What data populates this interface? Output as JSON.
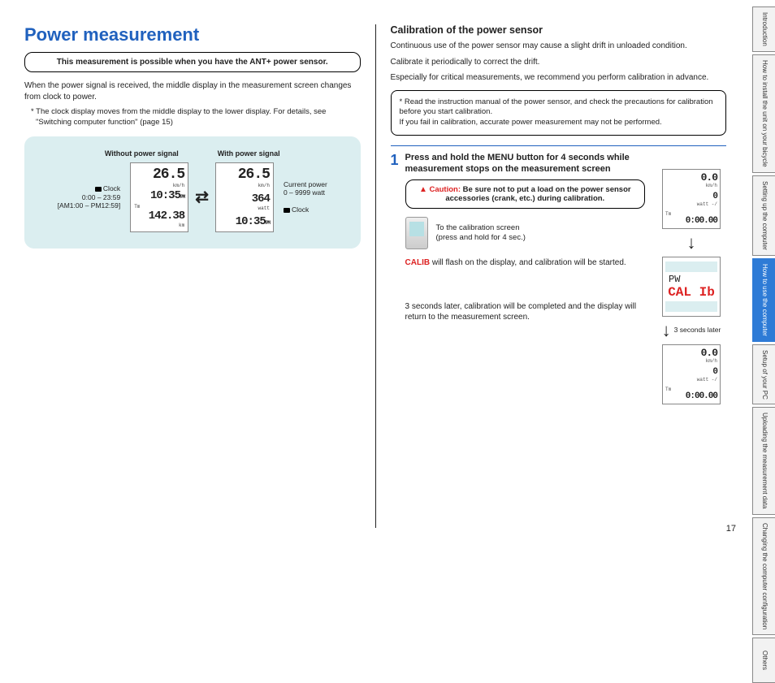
{
  "left": {
    "title": "Power measurement",
    "notice": "This measurement is possible when you have the ANT+ power sensor.",
    "intro": "When the power signal is received, the middle display in the measurement screen changes from clock to power.",
    "footnote": "* The clock display moves from the middle display to the lower display. For details, see \"Switching computer function\" (page 15)",
    "compare": {
      "header_left": "Without power signal",
      "header_right": "With power signal",
      "anno_clock_label": "Clock",
      "anno_clock_range": "0:00 – 23:59",
      "anno_clock_ampm": "[AM1:00 – PM12:59]",
      "anno_power_label": "Current power",
      "anno_power_range": "0 – 9999 watt",
      "anno_clock2": "Clock",
      "lcd_left": {
        "speed": "26.5",
        "unit1": "km/h",
        "time": "10:35",
        "ampm": "PM",
        "tm": "Tm",
        "trip": "142.38",
        "unit2": "km"
      },
      "lcd_right": {
        "speed": "26.5",
        "unit1": "km/h",
        "power": "364",
        "unit2": "watt",
        "time": "10:35",
        "ampm": "PM"
      }
    }
  },
  "right": {
    "subhead": "Calibration of the power sensor",
    "p1": "Continuous use of the power sensor may cause a slight drift in unloaded condition.",
    "p2": "Calibrate it periodically to correct the drift.",
    "p3": "Especially for critical measurements, we recommend you perform calibration in advance.",
    "infobox": "* Read the instruction manual of the power sensor, and check the precautions for calibration before you start calibration.\nIf you fail in calibration, accurate power measurement may not be performed.",
    "step_num": "1",
    "step_title": "Press and hold the MENU button for 4 seconds while measurement stops on the measurement screen",
    "caution_label": "Caution:",
    "caution_text": "Be sure not to put a load on the power sensor accessories (crank, etc.) during calibration.",
    "device_line1": "To the calibration screen",
    "device_line2": "(press and hold for 4 sec.)",
    "calib_word": "CALIB",
    "calib_tail": " will flash on the display, and calibration will be started.",
    "seq_timing": "3 seconds later",
    "return_text": "3 seconds later, calibration will be completed and the display will return to the measurement screen.",
    "lcd_seq": {
      "a": {
        "speed": "0.0",
        "unit1": "km/h",
        "power": "0",
        "unit2": "watt -/",
        "tm": "Tm",
        "trip": "0:00.00"
      },
      "b": {
        "pw": "PW",
        "calib": "CAL Ib"
      },
      "c": {
        "speed": "0.0",
        "unit1": "km/h",
        "power": "0",
        "unit2": "watt -/",
        "tm": "Tm",
        "trip": "0:00.00"
      }
    }
  },
  "tabs": [
    {
      "label": "Introduction",
      "active": false
    },
    {
      "label": "How to install the unit on your bicycle",
      "active": false
    },
    {
      "label": "Setting up the computer",
      "active": false
    },
    {
      "label": "How to use the computer",
      "active": true
    },
    {
      "label": "Setup of your PC",
      "active": false
    },
    {
      "label": "Uploading the measurement data",
      "active": false
    },
    {
      "label": "Changing the computer configuration",
      "active": false
    },
    {
      "label": "Others",
      "active": false
    }
  ],
  "page_number": "17"
}
